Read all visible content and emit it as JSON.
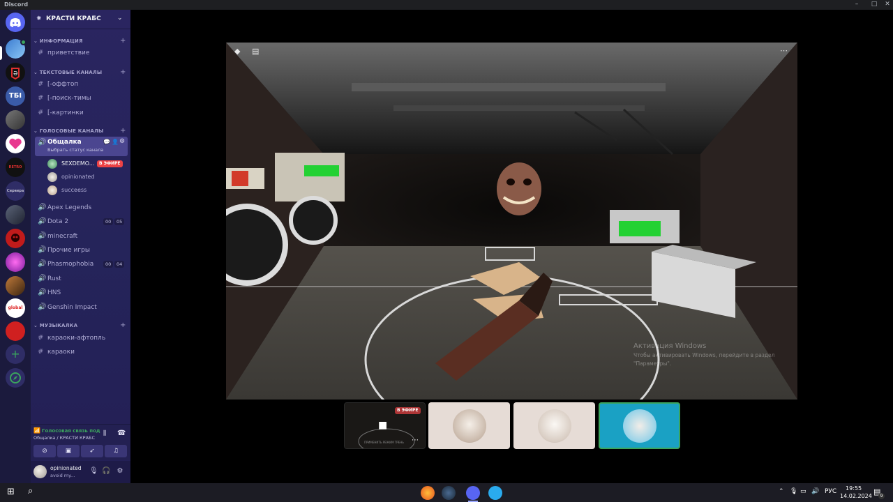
{
  "window": {
    "title": "Discord"
  },
  "server": {
    "name": "КРАСТИ КРАБС"
  },
  "guilds": [
    {
      "name": "guild-1"
    },
    {
      "name": "guild-2"
    },
    {
      "name": "guild-3"
    },
    {
      "name": "guild-4"
    },
    {
      "name": "guild-5"
    },
    {
      "name": "guild-6"
    },
    {
      "name": "Сервера"
    },
    {
      "name": "guild-8"
    },
    {
      "name": "guild-9"
    },
    {
      "name": "guild-10"
    },
    {
      "name": "guild-11"
    },
    {
      "name": "global"
    },
    {
      "name": "guild-13"
    }
  ],
  "guild_labels": {
    "folder": "Сервера",
    "global": "global",
    "retro": "RETRO",
    "tbi": "ТБI"
  },
  "categories": {
    "info": "ИНФОРМАЦИЯ",
    "text": "ТЕКСТОВЫЕ КАНАЛЫ",
    "voice": "ГОЛОСОВЫЕ КАНАЛЫ",
    "music": "МУЗЫКАЛКА"
  },
  "channels": {
    "welcome": "приветствие",
    "offtop": "[-оффтоп",
    "search": "[-поиск-тимы",
    "pics": "[-картинки",
    "active": {
      "name": "Общалка",
      "status_hint": "Выбрать статус канала"
    },
    "voice_users": [
      {
        "name": "SEXDEMO...",
        "live": "В ЭФИРЕ"
      },
      {
        "name": "opinionated"
      },
      {
        "name": "succeess"
      }
    ],
    "apex": "Apex Legends",
    "dota": {
      "name": "Dota 2",
      "count_a": "00",
      "count_b": "05"
    },
    "minecraft": "minecraft",
    "other": "Прочие игры",
    "phasmo": {
      "name": "Phasmophobia",
      "count_a": "00",
      "count_b": "04"
    },
    "rust": "Rust",
    "hns": "HNS",
    "genshin": "Genshin Impact",
    "karaoke_aftpl": "караоки-афтопль",
    "karaoke": "караоки"
  },
  "voice_panel": {
    "status": "Голосовая связь под",
    "location": "Общалка / КРАСТИ КРАБС"
  },
  "user": {
    "name": "opinionated",
    "status": "avoid my..."
  },
  "stream": {
    "live_badge": "В ЭФИРЕ",
    "watermark_title": "Активация Windows",
    "watermark_text": "Чтобы активировать Windows, перейдите в раздел",
    "watermark_text2": "\"Параметры\".",
    "preview_caption": "ПРИМЕНИТЬ РЕЖИМ ТРЕНЬ"
  },
  "taskbar": {
    "lang": "РУС",
    "time": "19:55",
    "date": "14.02.2024",
    "notif_count": "9"
  },
  "colors": {
    "accent": "#5865f2",
    "live": "#ed4245",
    "voice_ok": "#3ba55d",
    "selected_tile": "#1aa1c4"
  }
}
